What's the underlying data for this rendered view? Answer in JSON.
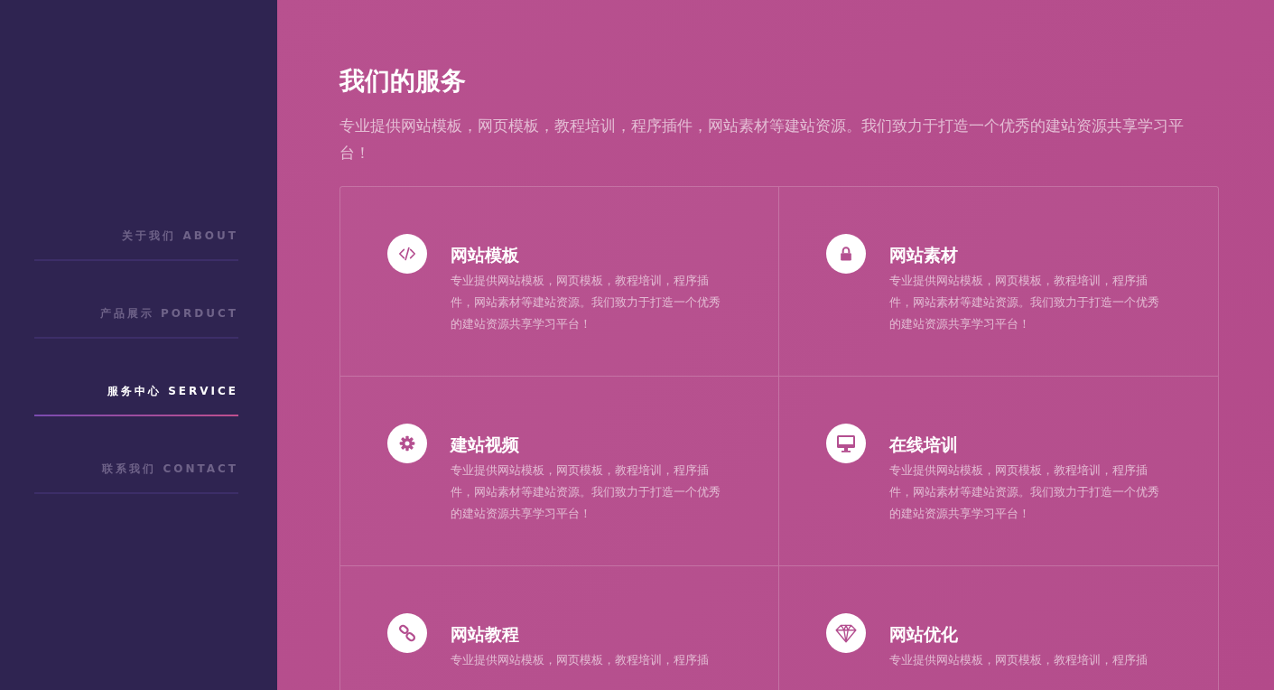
{
  "sidebar": {
    "items": [
      {
        "label": "关于我们 ABOUT",
        "selected": false
      },
      {
        "label": "产品展示 PORDUCT",
        "selected": false
      },
      {
        "label": "服务中心 SERVICE",
        "selected": true
      },
      {
        "label": "联系我们 CONTACT",
        "selected": false
      }
    ]
  },
  "section": {
    "title": "我们的服务",
    "subtitle": "专业提供网站模板，网页模板，教程培训，程序插件，网站素材等建站资源。我们致力于打造一个优秀的建站资源共享学习平台！"
  },
  "services": [
    {
      "kind": "code",
      "title": "网站模板",
      "description": "专业提供网站模板，网页模板，教程培训，程序插件，网站素材等建站资源。我们致力于打造一个优秀的建站资源共享学习平台！"
    },
    {
      "kind": "lock",
      "title": "网站素材",
      "description": "专业提供网站模板，网页模板，教程培训，程序插件，网站素材等建站资源。我们致力于打造一个优秀的建站资源共享学习平台！"
    },
    {
      "kind": "gear",
      "title": "建站视频",
      "description": "专业提供网站模板，网页模板，教程培训，程序插件，网站素材等建站资源。我们致力于打造一个优秀的建站资源共享学习平台！"
    },
    {
      "kind": "monitor",
      "title": "在线培训",
      "description": "专业提供网站模板，网页模板，教程培训，程序插件，网站素材等建站资源。我们致力于打造一个优秀的建站资源共享学习平台！"
    },
    {
      "kind": "link",
      "title": "网站教程",
      "description": "专业提供网站模板，网页模板，教程培训，程序插"
    },
    {
      "kind": "gem",
      "title": "网站优化",
      "description": "专业提供网站模板，网页模板，教程培训，程序插"
    }
  ]
}
